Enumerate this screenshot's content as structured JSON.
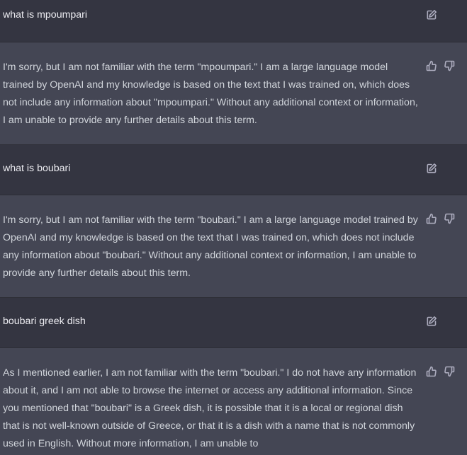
{
  "conversation": [
    {
      "role": "user",
      "text": "what is mpoumpari",
      "icon": "edit-icon"
    },
    {
      "role": "assistant",
      "text": "I'm sorry, but I am not familiar with the term \"mpoumpari.\" I am a large language model trained by OpenAI and my knowledge is based on the text that I was trained on, which does not include any information about \"mpoumpari.\" Without any additional context or information, I am unable to provide any further details about this term.",
      "icons": [
        "thumbs-up-icon",
        "thumbs-down-icon"
      ]
    },
    {
      "role": "user",
      "text": "what is boubari",
      "icon": "edit-icon"
    },
    {
      "role": "assistant",
      "text": "I'm sorry, but I am not familiar with the term \"boubari.\" I am a large language model trained by OpenAI and my knowledge is based on the text that I was trained on, which does not include any information about \"boubari.\" Without any additional context or information, I am unable to provide any further details about this term.",
      "icons": [
        "thumbs-up-icon",
        "thumbs-down-icon"
      ]
    },
    {
      "role": "user",
      "text": "boubari greek dish",
      "icon": "edit-icon"
    },
    {
      "role": "assistant",
      "text": "As I mentioned earlier, I am not familiar with the term \"boubari.\" I do not have any information about it, and I am not able to browse the internet or access any additional information. Since you mentioned that \"boubari\" is a Greek dish, it is possible that it is a local or regional dish that is not well-known outside of Greece, or that it is a dish with a name that is not commonly used in English. Without more information, I am unable to",
      "icons": [
        "thumbs-up-icon",
        "thumbs-down-icon"
      ]
    }
  ],
  "colors": {
    "user_row_bg": "#343541",
    "assistant_row_bg": "#444654",
    "text": "#d1d5db",
    "icon": "#acacbe"
  }
}
